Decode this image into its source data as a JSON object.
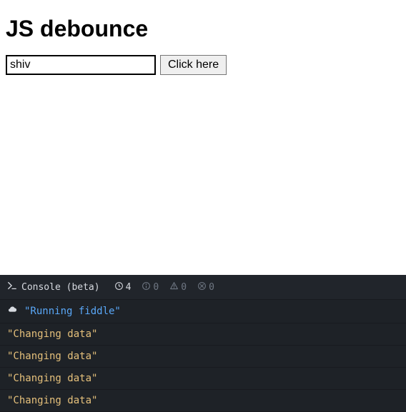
{
  "header": {
    "title": "JS debounce"
  },
  "controls": {
    "input_value": "shiv",
    "button_label": "Click here"
  },
  "console": {
    "title": "Console (beta)",
    "stats": {
      "logs": "4",
      "info": "0",
      "warnings": "0",
      "errors": "0"
    },
    "rows": [
      {
        "type": "system",
        "text": "\"Running fiddle\""
      },
      {
        "type": "plain",
        "text": "\"Changing data\""
      },
      {
        "type": "plain",
        "text": "\"Changing data\""
      },
      {
        "type": "plain",
        "text": "\"Changing data\""
      },
      {
        "type": "plain",
        "text": "\"Changing data\""
      }
    ]
  }
}
